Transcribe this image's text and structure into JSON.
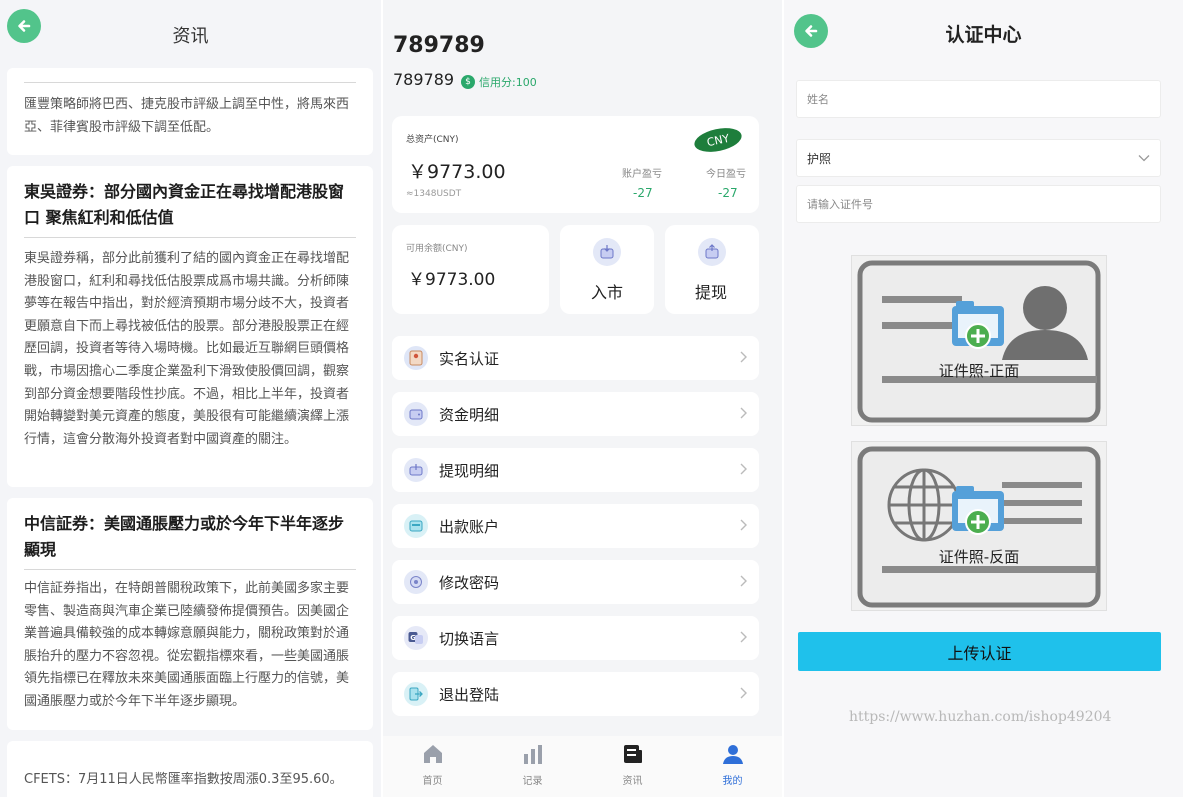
{
  "news_screen": {
    "title": "资讯",
    "articles": [
      {
        "headline": "",
        "body": "匯豐策略師將巴西、捷克股市評級上調至中性，將馬來西亞、菲律賓股市評級下調至低配。"
      },
      {
        "headline": "東吳證券：部分國內資金正在尋找增配港股窗口 聚焦紅利和低估值",
        "body": "東吳證券稱，部分此前獲利了結的國內資金正在尋找增配港股窗口，紅利和尋找低估股票成爲市場共識。分析師陳夢等在報告中指出，對於經濟預期市場分歧不大，投資者更願意自下而上尋找被低估的股票。部分港股股票正在經歷回調，投資者等待入場時機。比如最近互聯網巨頭價格戰，市場因擔心二季度企業盈利下滑致使股價回調，觀察到部分資金想要階段性抄底。不過，相比上半年，投資者開始轉變對美元資產的態度，美股很有可能繼續演繹上漲行情，這會分散海外投資者對中國資產的關注。"
      },
      {
        "headline": "中信証券：美國通脹壓力或於今年下半年逐步顯現",
        "body": "中信証券指出，在特朗普關稅政策下，此前美國多家主要零售、製造商與汽車企業已陸續發佈提價預告。因美國企業普遍具備較強的成本轉嫁意願與能力，關稅政策對於通脹抬升的壓力不容忽視。從宏觀指標來看，一些美國通脹領先指標已在釋放未來美國通脹面臨上行壓力的信號，美國通脹壓力或於今年下半年逐步顯現。"
      },
      {
        "headline": "",
        "body": "CFETS：7月11日人民幣匯率指數按周漲0.3至95.60。"
      }
    ]
  },
  "profile_screen": {
    "username": "789789",
    "user_id": "789789",
    "credit_label": "信用分:100",
    "total_assets": {
      "label": "总资产(CNY)",
      "amount": "￥9773.00",
      "usdt": "≈1348USDT",
      "currency_badge": "CNY",
      "account_pl_label": "账户盈亏",
      "account_pl_value": "-27",
      "today_pl_label": "今日盈亏",
      "today_pl_value": "-27"
    },
    "available": {
      "label": "可用余额(CNY)",
      "amount": "￥9773.00"
    },
    "actions": {
      "deposit": "入市",
      "withdraw": "提现"
    },
    "menu": [
      {
        "label": "实名认证",
        "icon": "id-card-icon"
      },
      {
        "label": "资金明细",
        "icon": "wallet-icon"
      },
      {
        "label": "提现明细",
        "icon": "withdraw-icon"
      },
      {
        "label": "出款账户",
        "icon": "bank-card-icon"
      },
      {
        "label": "修改密码",
        "icon": "lock-icon"
      },
      {
        "label": "切换语言",
        "icon": "language-icon"
      },
      {
        "label": "退出登陆",
        "icon": "logout-icon"
      }
    ],
    "tabs": [
      {
        "label": "首页",
        "icon": "home-icon",
        "active": false
      },
      {
        "label": "记录",
        "icon": "chart-icon",
        "active": false
      },
      {
        "label": "资讯",
        "icon": "news-icon",
        "active": false
      },
      {
        "label": "我的",
        "icon": "user-icon",
        "active": true
      }
    ]
  },
  "auth_screen": {
    "title": "认证中心",
    "name_placeholder": "姓名",
    "id_type_selected": "护照",
    "id_number_placeholder": "请输入证件号",
    "front_caption": "证件照-正面",
    "back_caption": "证件照-反面",
    "submit_label": "上传认证",
    "watermark": "https://www.huzhan.com/ishop49204"
  },
  "colors": {
    "green": "#52c48b",
    "profit_green": "#2aa86b",
    "upload_cyan": "#1fc1eb",
    "tab_active": "#2f6fd8"
  }
}
